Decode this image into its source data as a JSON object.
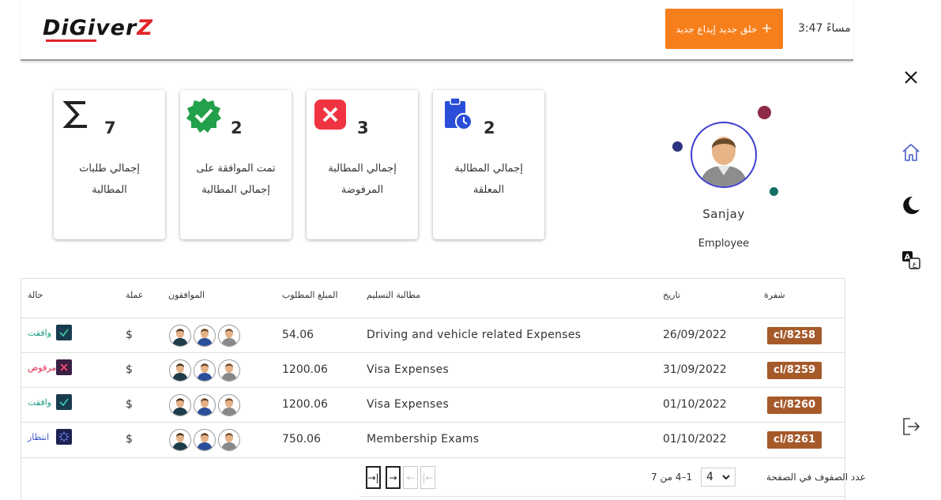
{
  "header": {
    "logo_text": "DiGiverZ",
    "create_button_label": "خلق جديد إيداع جديد",
    "create_button_icon": "plus-icon",
    "clock_text": "مساءً 3:47"
  },
  "rail": {
    "icons": [
      "close-icon",
      "home-icon",
      "dark-mode-icon",
      "translate-icon",
      "logout-icon"
    ]
  },
  "stats": [
    {
      "count": "7",
      "label": "إجمالي طلبات المطالبة",
      "icon": "sigma-icon"
    },
    {
      "count": "2",
      "label": "تمت الموافقة على إجمالي المطالبة",
      "icon": "approved-badge-icon",
      "color": "#23a14a"
    },
    {
      "count": "3",
      "label": "إجمالي المطالبة المرفوضة",
      "icon": "rejected-icon",
      "color": "#ef3340"
    },
    {
      "count": "2",
      "label": "إجمالي المطالبة المعلقة",
      "icon": "pending-clipboard-icon",
      "color": "#2b4ed8"
    }
  ],
  "profile": {
    "name": "Sanjay",
    "role": "Employee"
  },
  "table": {
    "headers": {
      "code": "شفرة",
      "date": "تاريخ",
      "claim": "مطالبة التسليم",
      "amount": "المبلغ المطلوب",
      "approvers": "الموافقون",
      "currency": "عملة",
      "status": "حالة"
    },
    "rows": [
      {
        "code": "cl/8258",
        "date": "26/09/2022",
        "claim": "Driving and vehicle related Expenses",
        "amount": "54.06",
        "currency": "$",
        "status": "وافقت",
        "status_kind": "approved"
      },
      {
        "code": "cl/8259",
        "date": "31/09/2022",
        "claim": "Visa Expenses",
        "amount": "1200.06",
        "currency": "$",
        "status": "مرفوض",
        "status_kind": "rejected"
      },
      {
        "code": "cl/8260",
        "date": "01/10/2022",
        "claim": "Visa Expenses",
        "amount": "1200.06",
        "currency": "$",
        "status": "وافقت",
        "status_kind": "approved"
      },
      {
        "code": "cl/8261",
        "date": "01/10/2022",
        "claim": "Membership Exams",
        "amount": "750.06",
        "currency": "$",
        "status": "انتظار",
        "status_kind": "pending"
      }
    ],
    "status_colors": {
      "approved": "#1a9a83",
      "rejected": "#e0294b",
      "pending": "#3a58c8"
    }
  },
  "pagination": {
    "rows_per_page_label": "عدد الصفوف في الصفحة",
    "rows_per_page": "4",
    "range_text": "1–4 من 7"
  }
}
